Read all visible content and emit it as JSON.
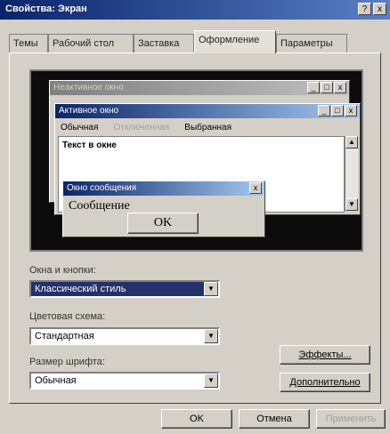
{
  "window": {
    "title": "Свойства: Экран",
    "help": "?",
    "close": "x"
  },
  "tabs": [
    "Темы",
    "Рабочий стол",
    "Заставка",
    "Оформление",
    "Параметры"
  ],
  "preview": {
    "inactive_title": "Неактивное окно",
    "active_title": "Активное окно",
    "menu": [
      "Обычная",
      "Отключенная",
      "Выбранная"
    ],
    "window_text": "Текст в окне",
    "message_title": "Окно сообщения",
    "message_text": "Сообщение",
    "ok": "OK"
  },
  "form": {
    "windows_label": "Окна и кнопки:",
    "windows_value": "Классический стиль",
    "scheme_label": "Цветовая схема:",
    "scheme_value": "Стандартная",
    "font_label": "Размер шрифта:",
    "font_value": "Обычная"
  },
  "side_buttons": {
    "effects": "Эффекты...",
    "advanced": "Дополнительно"
  },
  "footer": {
    "ok": "OK",
    "cancel": "Отмена",
    "apply": "Применить"
  }
}
